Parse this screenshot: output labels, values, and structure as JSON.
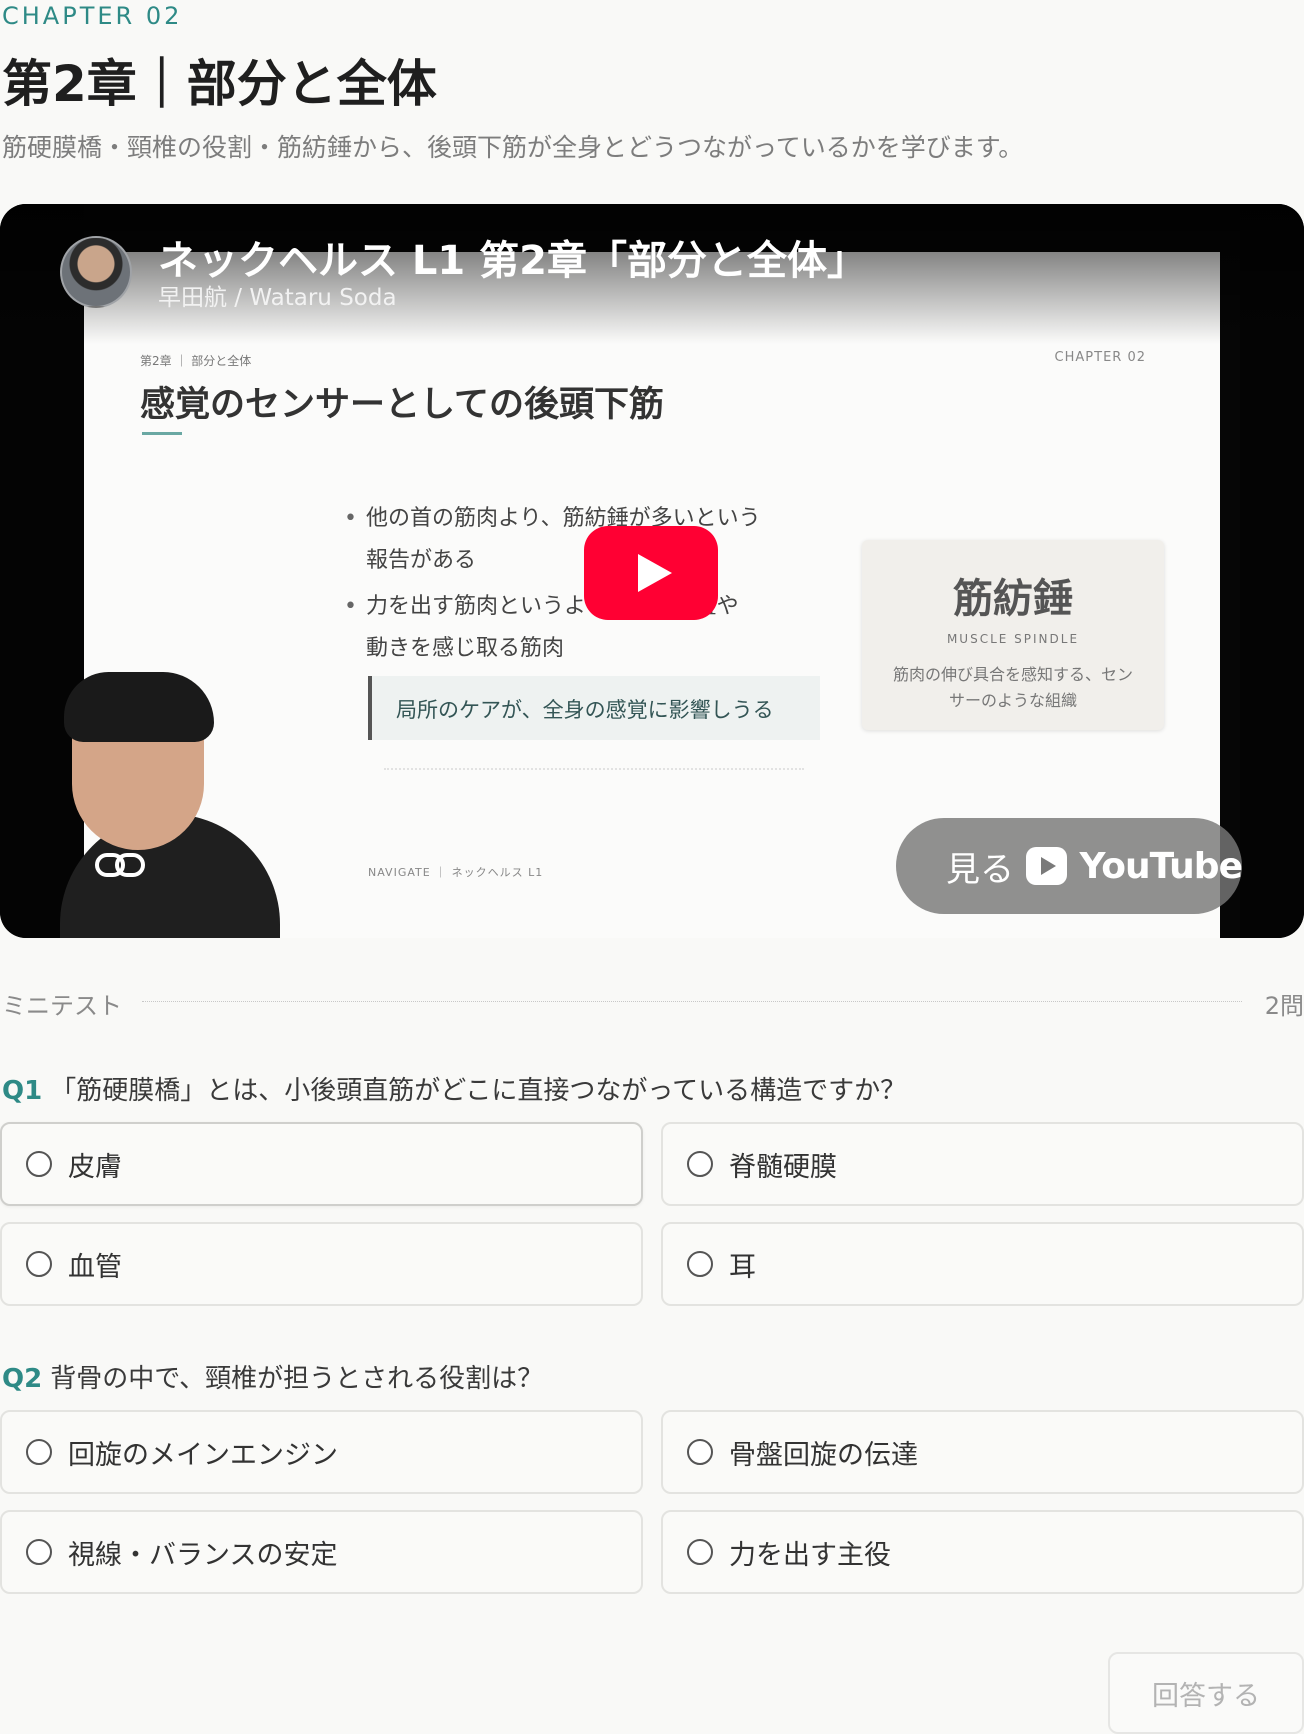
{
  "header": {
    "eyebrow": "CHAPTER 02",
    "title": "第2章｜部分と全体",
    "subtitle": "筋硬膜橋・頸椎の役割・筋紡錘から、後頭下筋が全身とどうつながっているかを学びます。"
  },
  "video": {
    "title": "ネックヘルス L1 第2章「部分と全体」",
    "author": "早田航 / Wataru Soda",
    "watch_label": "見る",
    "youtube_word": "YouTube",
    "slide": {
      "breadcrumb": "第2章 ｜ 部分と全体",
      "chapter": "CHAPTER 02",
      "heading": "感覚のセンサーとしての後頭下筋",
      "bullet1_line1": "他の首の筋肉より、筋紡錘が多いという",
      "bullet1_line2": "報告がある",
      "bullet2_line1": "力を出す筋肉というより、体の位置や",
      "bullet2_line2": "動きを感じ取る筋肉",
      "callout": "局所のケアが、全身の感覚に影響しうる",
      "card_title": "筋紡錘",
      "card_sub": "MUSCLE SPINDLE",
      "card_desc": "筋肉の伸び具合を感知する、センサーのような組織",
      "footer": "NAVIGATE ｜ ネックヘルス L1"
    }
  },
  "quiz": {
    "section_label": "ミニテスト",
    "count": "2問",
    "questions": [
      {
        "num": "Q1",
        "text": "「筋硬膜橋」とは、小後頭直筋がどこに直接つながっている構造ですか？",
        "options": [
          "皮膚",
          "脊髄硬膜",
          "血管",
          "耳"
        ]
      },
      {
        "num": "Q2",
        "text": "背骨の中で、頸椎が担うとされる役割は？",
        "options": [
          "回旋のメインエンジン",
          "骨盤回旋の伝達",
          "視線・バランスの安定",
          "力を出す主役"
        ]
      }
    ],
    "submit_label": "回答する"
  }
}
